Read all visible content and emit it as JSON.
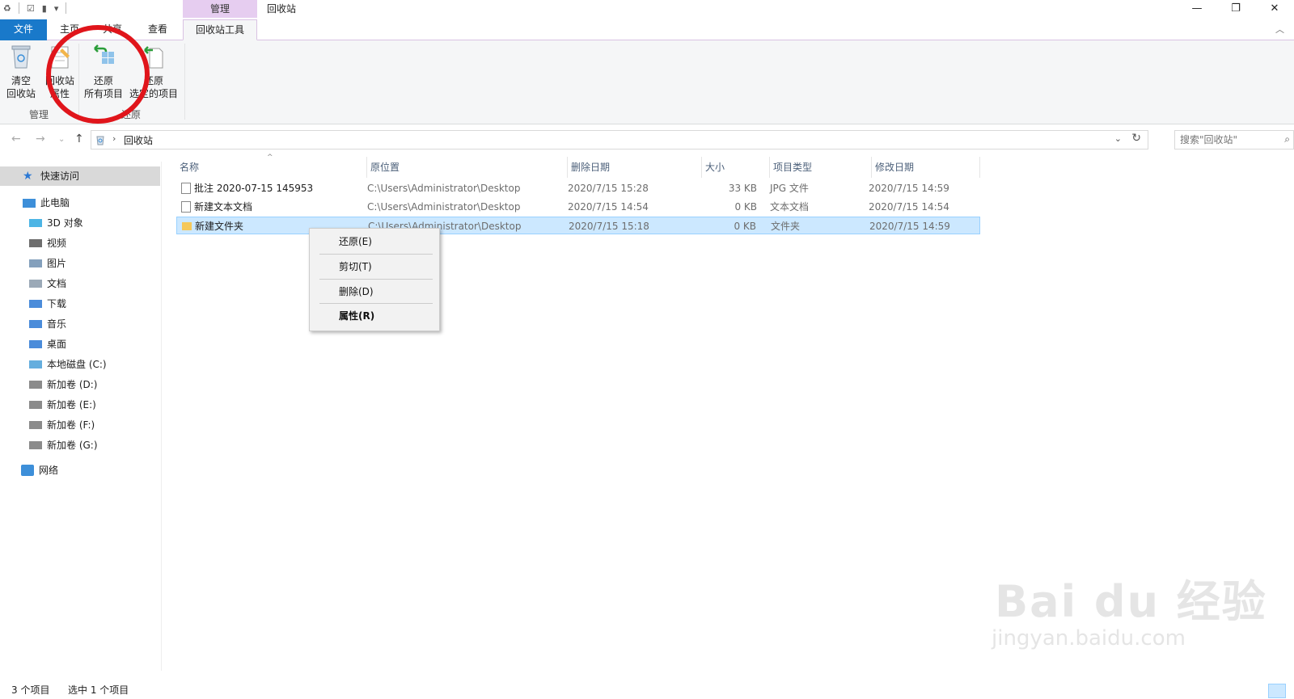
{
  "window": {
    "title": "回收站",
    "context_tab_group": "管理",
    "controls": {
      "minimize": "—",
      "maximize": "❐",
      "close": "✕"
    }
  },
  "ribbon": {
    "tabs": [
      {
        "label": "文件"
      },
      {
        "label": "主页"
      },
      {
        "label": "共享"
      },
      {
        "label": "查看"
      },
      {
        "label": "回收站工具"
      }
    ],
    "buttons": {
      "empty_bin": {
        "line1": "清空",
        "line2": "回收站"
      },
      "bin_props": {
        "line1": "回收站",
        "line2": "属性"
      },
      "restore_all": {
        "line1": "还原",
        "line2": "所有项目"
      },
      "restore_selected": {
        "line1": "还原",
        "line2": "选定的项目"
      }
    },
    "groups": {
      "manage": "管理",
      "restore": "还原"
    }
  },
  "address_bar": {
    "breadcrumb": "回收站",
    "search_placeholder": "搜索\"回收站\""
  },
  "sidebar": {
    "quick_access": "快速访问",
    "this_pc": "此电脑",
    "items": [
      {
        "label": "3D 对象",
        "icon": "3d-objects-icon"
      },
      {
        "label": "视频",
        "icon": "videos-icon"
      },
      {
        "label": "图片",
        "icon": "pictures-icon"
      },
      {
        "label": "文档",
        "icon": "documents-icon"
      },
      {
        "label": "下载",
        "icon": "downloads-icon"
      },
      {
        "label": "音乐",
        "icon": "music-icon"
      },
      {
        "label": "桌面",
        "icon": "desktop-icon"
      },
      {
        "label": "本地磁盘 (C:)",
        "icon": "local-disk-icon"
      },
      {
        "label": "新加卷 (D:)",
        "icon": "drive-icon"
      },
      {
        "label": "新加卷 (E:)",
        "icon": "drive-icon"
      },
      {
        "label": "新加卷 (F:)",
        "icon": "drive-icon"
      },
      {
        "label": "新加卷 (G:)",
        "icon": "drive-icon"
      }
    ],
    "network": "网络"
  },
  "file_list": {
    "columns": [
      "名称",
      "原位置",
      "删除日期",
      "大小",
      "项目类型",
      "修改日期"
    ],
    "rows": [
      {
        "name": "批注 2020-07-15 145953",
        "location": "C:\\Users\\Administrator\\Desktop",
        "deleted": "2020/7/15 15:28",
        "size": "33 KB",
        "type": "JPG 文件",
        "modified": "2020/7/15 14:59",
        "icon": "image-file-icon"
      },
      {
        "name": "新建文本文档",
        "location": "C:\\Users\\Administrator\\Desktop",
        "deleted": "2020/7/15 14:54",
        "size": "0 KB",
        "type": "文本文档",
        "modified": "2020/7/15 14:54",
        "icon": "text-file-icon"
      },
      {
        "name": "新建文件夹",
        "location": "C:\\Users\\Administrator\\Desktop",
        "deleted": "2020/7/15 15:18",
        "size": "0 KB",
        "type": "文件夹",
        "modified": "2020/7/15 14:59",
        "icon": "folder-icon",
        "selected": true
      }
    ]
  },
  "context_menu": {
    "restore": "还原(E)",
    "cut": "剪切(T)",
    "delete": "删除(D)",
    "properties": "属性(R)"
  },
  "status_bar": {
    "item_count": "3 个项目",
    "selected_count": "选中 1 个项目"
  },
  "watermark": {
    "brand": "Bai du 经验",
    "url": "jingyan.baidu.com"
  },
  "colors": {
    "file_tab": "#1979ca",
    "context_tab": "#e6cdf0",
    "selection": "#cce8ff",
    "annotation": "#e0151b"
  }
}
